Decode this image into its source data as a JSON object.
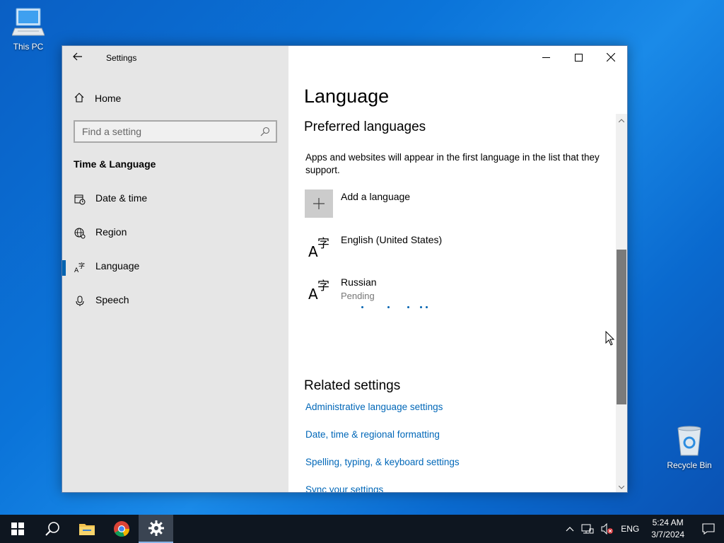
{
  "desktop": {
    "icons": [
      {
        "label": "This PC"
      },
      {
        "label": "Recycle Bin"
      }
    ]
  },
  "window": {
    "title": "Settings",
    "sidebar": {
      "home_label": "Home",
      "search_placeholder": "Find a setting",
      "section_title": "Time & Language",
      "items": [
        {
          "label": "Date & time",
          "icon": "calendar-clock-icon"
        },
        {
          "label": "Region",
          "icon": "globe-icon"
        },
        {
          "label": "Language",
          "icon": "language-icon",
          "active": true
        },
        {
          "label": "Speech",
          "icon": "microphone-icon"
        }
      ]
    },
    "content": {
      "page_title": "Language",
      "preferred_heading": "Preferred languages",
      "description": "Apps and websites will appear in the first language in the list that they support.",
      "add_language_label": "Add a language",
      "languages": [
        {
          "name": "English (United States)",
          "status": ""
        },
        {
          "name": "Russian",
          "status": "Pending"
        }
      ],
      "related_heading": "Related settings",
      "related_links": [
        "Administrative language settings",
        "Date, time & regional formatting",
        "Spelling, typing, & keyboard settings",
        "Sync your settings"
      ]
    }
  },
  "taskbar": {
    "tray": {
      "language": "ENG",
      "time": "5:24 AM",
      "date": "3/7/2024"
    }
  },
  "colors": {
    "accent": "#0063b1",
    "link": "#0067b8",
    "sidebar_bg": "#e6e6e6",
    "taskbar_bg": "#0e1620"
  }
}
